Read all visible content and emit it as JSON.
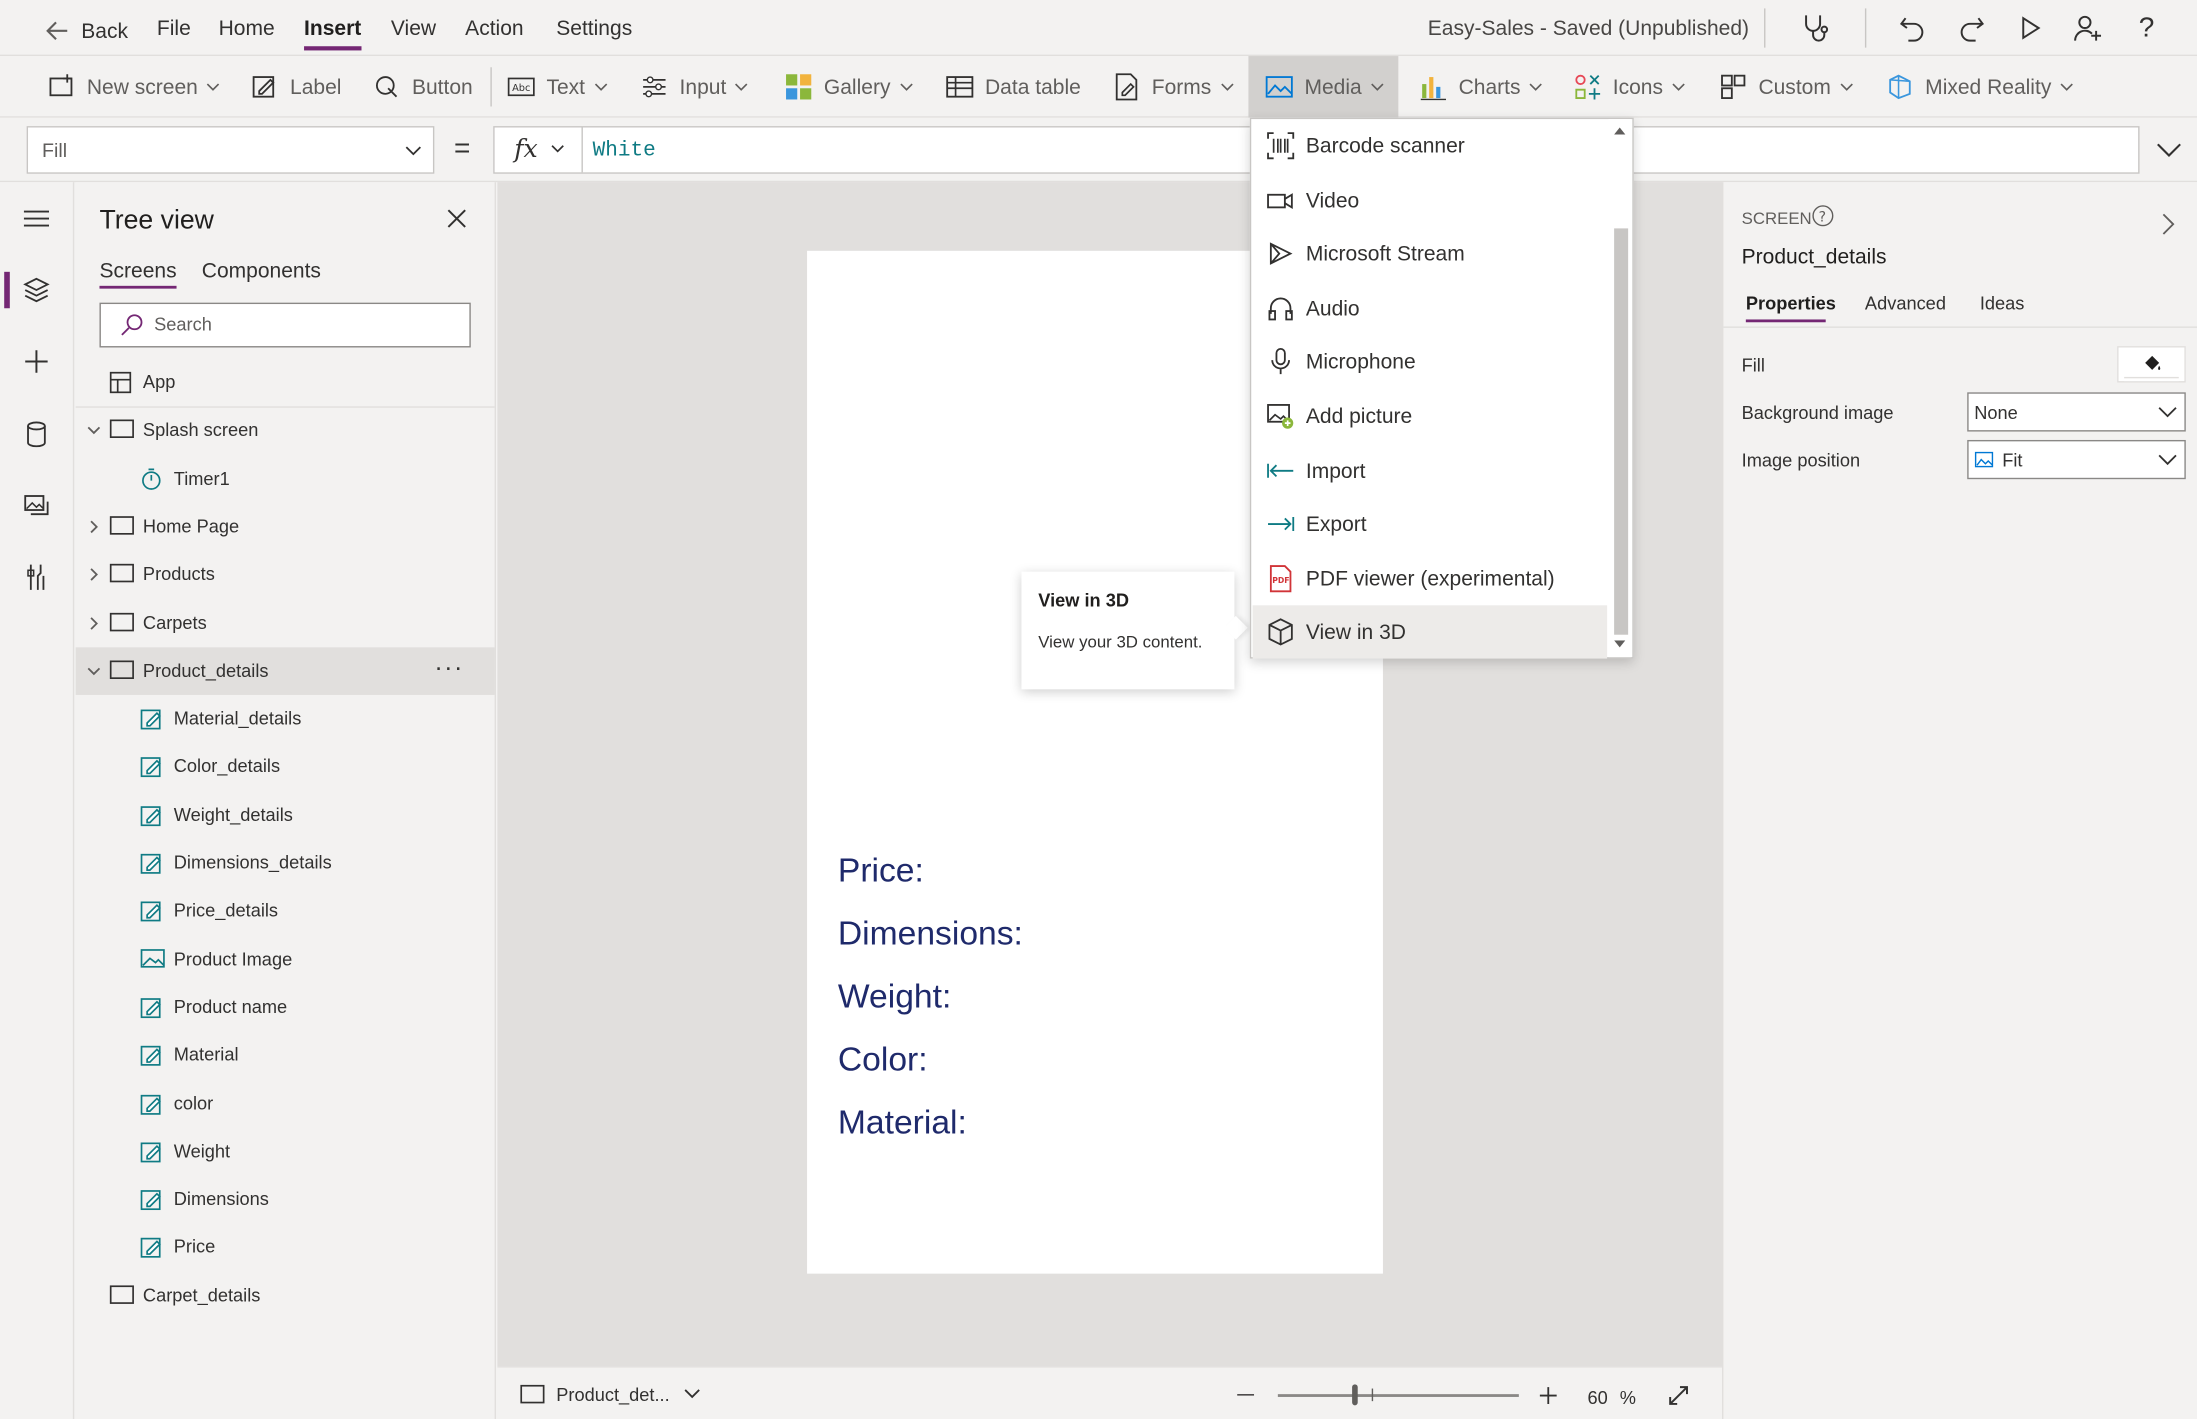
{
  "topbar": {
    "back": "Back",
    "menus": [
      "File",
      "Home",
      "Insert",
      "View",
      "Action",
      "Settings"
    ],
    "active_menu": "Insert",
    "app_title": "Easy-Sales - Saved (Unpublished)"
  },
  "ribbon": {
    "items": [
      "New screen",
      "Label",
      "Button",
      "Text",
      "Input",
      "Gallery",
      "Data table",
      "Forms",
      "Media",
      "Charts",
      "Icons",
      "Custom",
      "Mixed Reality"
    ],
    "active": "Media"
  },
  "formula": {
    "property": "Fill",
    "equals": "=",
    "fx": "fx",
    "value": "White"
  },
  "tree": {
    "title": "Tree view",
    "tabs": [
      "Screens",
      "Components"
    ],
    "search_placeholder": "Search",
    "nodes": [
      {
        "label": "App",
        "icon": "app-icon",
        "level": 0
      },
      {
        "label": "Splash screen",
        "icon": "screen-icon",
        "level": 0,
        "expander": "expanded"
      },
      {
        "label": "Timer1",
        "icon": "timer-icon",
        "level": 1
      },
      {
        "label": "Home Page",
        "icon": "screen-icon",
        "level": 0,
        "expander": "collapsed"
      },
      {
        "label": "Products",
        "icon": "screen-icon",
        "level": 0,
        "expander": "collapsed"
      },
      {
        "label": "Carpets",
        "icon": "screen-icon",
        "level": 0,
        "expander": "collapsed"
      },
      {
        "label": "Product_details",
        "icon": "screen-icon",
        "level": 0,
        "expander": "expanded",
        "selected": true
      },
      {
        "label": "Material_details",
        "icon": "edit-label-icon",
        "level": 1
      },
      {
        "label": "Color_details",
        "icon": "edit-label-icon",
        "level": 1
      },
      {
        "label": "Weight_details",
        "icon": "edit-label-icon",
        "level": 1
      },
      {
        "label": "Dimensions_details",
        "icon": "edit-label-icon",
        "level": 1
      },
      {
        "label": "Price_details",
        "icon": "edit-label-icon",
        "level": 1
      },
      {
        "label": "Product Image",
        "icon": "image-icon",
        "level": 1
      },
      {
        "label": "Product name",
        "icon": "edit-label-icon",
        "level": 1
      },
      {
        "label": "Material",
        "icon": "edit-label-icon",
        "level": 1
      },
      {
        "label": "color",
        "icon": "edit-label-icon",
        "level": 1
      },
      {
        "label": "Weight",
        "icon": "edit-label-icon",
        "level": 1
      },
      {
        "label": "Dimensions",
        "icon": "edit-label-icon",
        "level": 1
      },
      {
        "label": "Price",
        "icon": "edit-label-icon",
        "level": 1
      },
      {
        "label": "Carpet_details",
        "icon": "screen-icon",
        "level": 0
      }
    ]
  },
  "canvas": {
    "labels": [
      "Price:",
      "Dimensions:",
      "Weight:",
      "Color:",
      "Material:"
    ]
  },
  "status": {
    "screen_name": "Product_det...",
    "zoom": "60",
    "zoom_unit": "%"
  },
  "right_panel": {
    "section": "SCREEN",
    "name": "Product_details",
    "tabs": [
      "Properties",
      "Advanced",
      "Ideas"
    ],
    "fill_label": "Fill",
    "bg_image_label": "Background image",
    "bg_image_value": "None",
    "image_position_label": "Image position",
    "image_position_value": "Fit"
  },
  "media_menu": {
    "items": [
      {
        "label": "Barcode scanner",
        "icon": "barcode-icon"
      },
      {
        "label": "Video",
        "icon": "video-icon"
      },
      {
        "label": "Microsoft Stream",
        "icon": "stream-icon"
      },
      {
        "label": "Audio",
        "icon": "headphones-icon"
      },
      {
        "label": "Microphone",
        "icon": "microphone-icon"
      },
      {
        "label": "Add picture",
        "icon": "add-picture-icon"
      },
      {
        "label": "Import",
        "icon": "import-icon"
      },
      {
        "label": "Export",
        "icon": "export-icon"
      },
      {
        "label": "PDF viewer (experimental)",
        "icon": "pdf-icon"
      },
      {
        "label": "View in 3D",
        "icon": "cube-icon"
      }
    ],
    "highlighted": "View in 3D"
  },
  "tooltip": {
    "title": "View in 3D",
    "description": "View your 3D content."
  },
  "colors": {
    "accent": "#742774",
    "formula_value": "#0f7b84",
    "canvas_text": "#1f2a6b"
  }
}
